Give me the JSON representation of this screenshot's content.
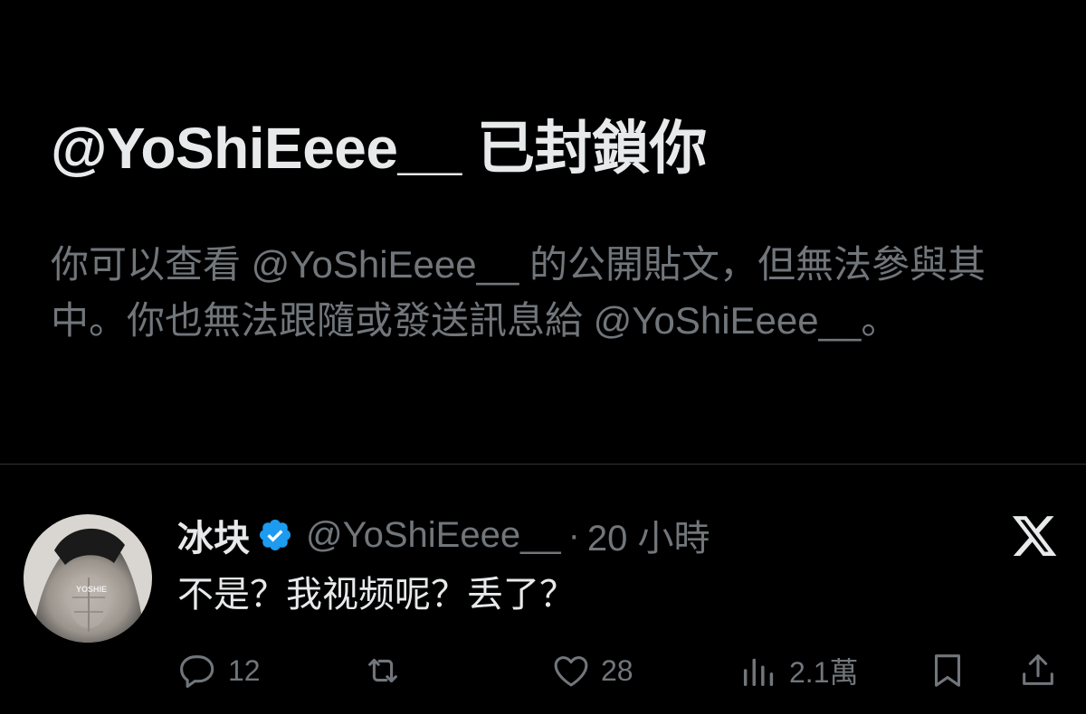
{
  "blocked": {
    "title": "@YoShiEeee__ 已封鎖你",
    "description": "你可以查看 @YoShiEeee__ 的公開貼文，但無法參與其中。你也無法跟隨或發送訊息給 @YoShiEeee__。"
  },
  "tweet": {
    "display_name": "冰块",
    "handle": "@YoShiEeee__",
    "separator": "·",
    "time": "20 小時",
    "text": "不是？我视频呢？丢了？",
    "avatar_watermark": "YOSHIE",
    "verified_badge_color": "#1d9bf0"
  },
  "actions": {
    "reply_count": "12",
    "retweet_count": "",
    "like_count": "28",
    "views_count": "2.1萬"
  },
  "icons": [
    "reply-icon",
    "retweet-icon",
    "like-icon",
    "views-icon",
    "bookmark-icon",
    "share-icon",
    "x-logo-icon",
    "verified-icon"
  ],
  "colors": {
    "background": "#000000",
    "primary_text": "#e7e9ea",
    "secondary_text": "#71767b",
    "divider": "#2f3336"
  }
}
